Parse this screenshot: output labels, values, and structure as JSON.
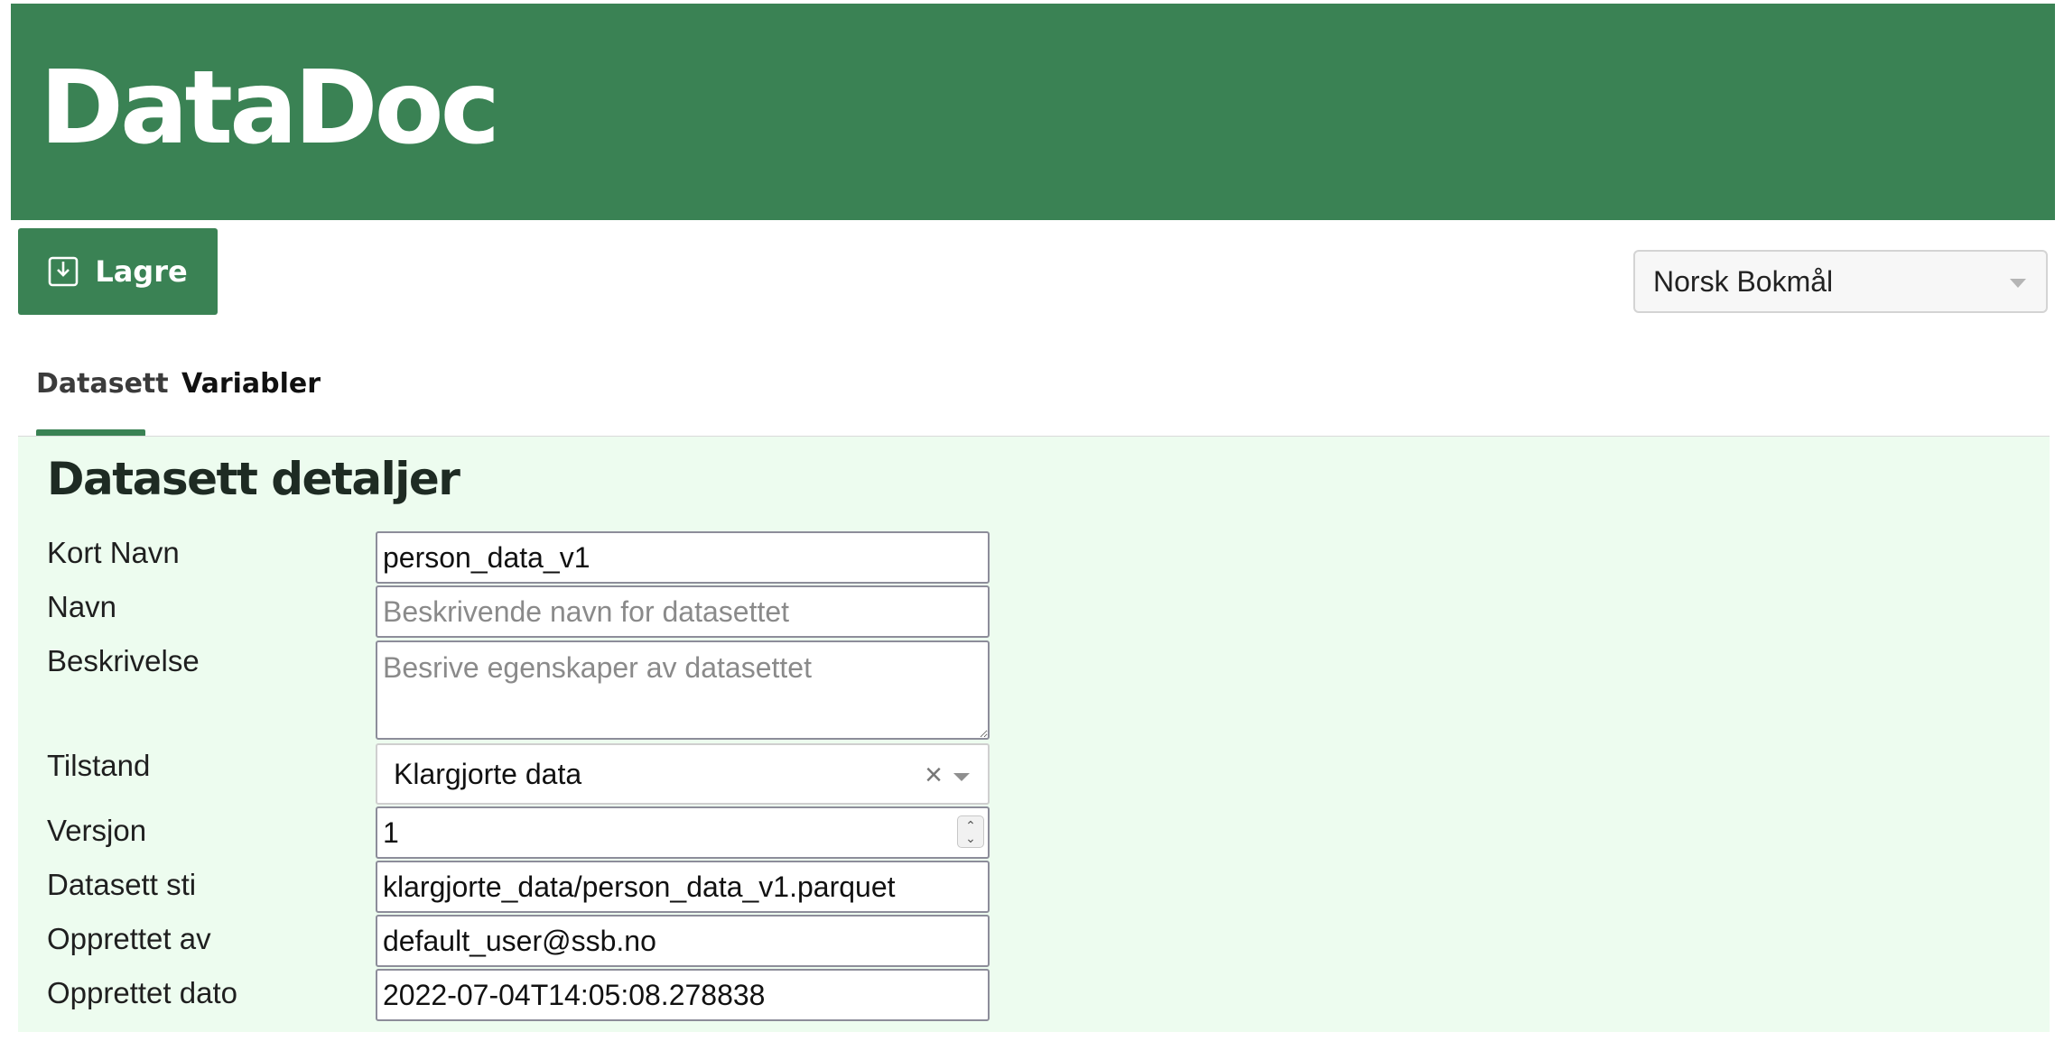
{
  "app": {
    "title": "DataDoc"
  },
  "toolbar": {
    "save_label": "Lagre",
    "save_icon": "save-icon"
  },
  "language_select": {
    "value": "Norsk Bokmål"
  },
  "tabs": [
    {
      "label": "Datasett",
      "active": true
    },
    {
      "label": "Variabler",
      "active": false
    }
  ],
  "section": {
    "title": "Datasett detaljer"
  },
  "form": {
    "short_name": {
      "label": "Kort Navn",
      "value": "person_data_v1"
    },
    "name": {
      "label": "Navn",
      "value": "",
      "placeholder": "Beskrivende navn for datasettet"
    },
    "description": {
      "label": "Beskrivelse",
      "value": "",
      "placeholder": "Besrive egenskaper av datasettet"
    },
    "state": {
      "label": "Tilstand",
      "value": "Klargjorte data"
    },
    "version": {
      "label": "Versjon",
      "value": "1"
    },
    "path": {
      "label": "Datasett sti",
      "value": "klargjorte_data/person_data_v1.parquet"
    },
    "created_by": {
      "label": "Opprettet av",
      "value": "default_user@ssb.no"
    },
    "created_date": {
      "label": "Opprettet dato",
      "value": "2022-07-04T14:05:08.278838"
    }
  },
  "colors": {
    "brand": "#3a8254",
    "panel": "#edfcef"
  }
}
